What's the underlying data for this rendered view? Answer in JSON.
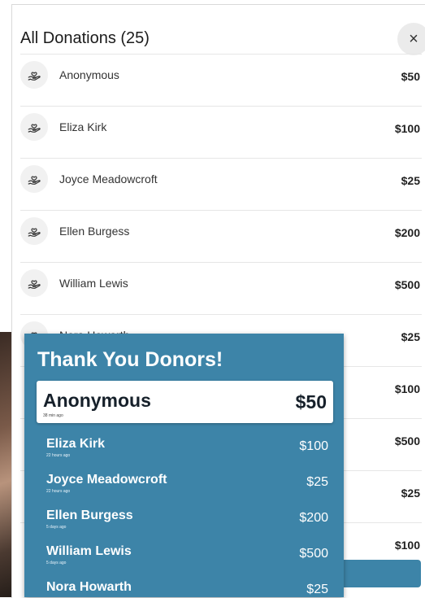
{
  "panel": {
    "title": "All Donations (25)",
    "close_label": "×",
    "items": [
      {
        "name": "Anonymous",
        "amount": "$50"
      },
      {
        "name": "Eliza Kirk",
        "amount": "$100"
      },
      {
        "name": "Joyce Meadowcroft",
        "amount": "$25"
      },
      {
        "name": "Ellen Burgess",
        "amount": "$200"
      },
      {
        "name": "William Lewis",
        "amount": "$500"
      },
      {
        "name": "Nora Howarth",
        "amount": "$25"
      },
      {
        "name": "",
        "amount": "$100"
      },
      {
        "name": "",
        "amount": "$500"
      },
      {
        "name": "",
        "amount": "$25"
      },
      {
        "name": "",
        "amount": "$100"
      }
    ]
  },
  "widget": {
    "title": "Thank You Donors!",
    "featured": {
      "name": "Anonymous",
      "time": "38 min ago",
      "amount": "$50"
    },
    "rows": [
      {
        "name": "Eliza Kirk",
        "time": "22 hours ago",
        "amount": "$100"
      },
      {
        "name": "Joyce Meadowcroft",
        "time": "22 hours ago",
        "amount": "$25"
      },
      {
        "name": "Ellen Burgess",
        "time": "5 days ago",
        "amount": "$200"
      },
      {
        "name": "William Lewis",
        "time": "5 days ago",
        "amount": "$500"
      },
      {
        "name": "Nora Howarth",
        "time": "",
        "amount": "$25"
      }
    ]
  },
  "icons": {
    "donor": "hand-heart-icon",
    "close": "close-icon"
  },
  "colors": {
    "accent": "#3d84a8"
  }
}
